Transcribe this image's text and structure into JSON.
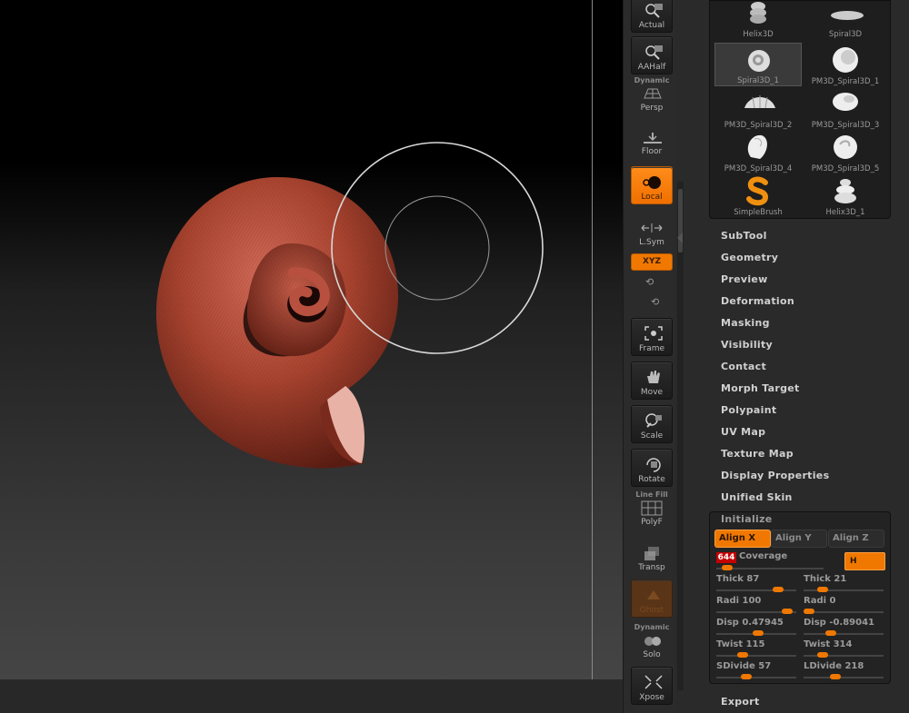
{
  "shelf": {
    "actual": "Actual",
    "aahalf": "AAHalf",
    "persp_top": "Dynamic",
    "persp": "Persp",
    "floor": "Floor",
    "local": "Local",
    "lsym": "L.Sym",
    "xyz": "XYZ",
    "frame": "Frame",
    "move": "Move",
    "scale": "Scale",
    "rotate": "Rotate",
    "polyf_top": "Line Fill",
    "polyf": "PolyF",
    "transp": "Transp",
    "ghost": "Ghost",
    "solo_top": "Dynamic",
    "solo": "Solo",
    "xpose": "Xpose",
    "colors": {
      "active": "#f07800"
    }
  },
  "brushes": [
    {
      "name": "Helix3D"
    },
    {
      "name": "Spiral3D"
    },
    {
      "name": "Spiral3D_1"
    },
    {
      "name": "PM3D_Spiral3D_1"
    },
    {
      "name": "PM3D_Spiral3D_2"
    },
    {
      "name": "PM3D_Spiral3D_3"
    },
    {
      "name": "PM3D_Spiral3D_4"
    },
    {
      "name": "PM3D_Spiral3D_5"
    },
    {
      "name": "SimpleBrush"
    },
    {
      "name": "Helix3D_1"
    }
  ],
  "menu": {
    "subtool": "SubTool",
    "geometry": "Geometry",
    "preview": "Preview",
    "deformation": "Deformation",
    "masking": "Masking",
    "visibility": "Visibility",
    "contact": "Contact",
    "morph_target": "Morph Target",
    "polypaint": "Polypaint",
    "uv_map": "UV Map",
    "texture_map": "Texture Map",
    "display_properties": "Display Properties",
    "unified_skin": "Unified Skin",
    "initialize": "Initialize",
    "export": "Export"
  },
  "initialize": {
    "align_x": "Align X",
    "align_y": "Align Y",
    "align_z": "Align Z",
    "coverage_value": "644",
    "coverage_label": "Coverage",
    "h_button": "H",
    "sliders": [
      {
        "label": "Thick 87",
        "level": 0.82
      },
      {
        "label": "Thick 21",
        "level": 0.2
      },
      {
        "label": "Radi 100",
        "level": 0.95
      },
      {
        "label": "Radi 0",
        "level": 0.0
      },
      {
        "label": "Disp 0.47945",
        "level": 0.52
      },
      {
        "label": "Disp -0.89041",
        "level": 0.32
      },
      {
        "label": "Twist 115",
        "level": 0.3
      },
      {
        "label": "Twist 314",
        "level": 0.2
      },
      {
        "label": "SDivide 57",
        "level": 0.35
      },
      {
        "label": "LDivide 218",
        "level": 0.38
      }
    ]
  }
}
